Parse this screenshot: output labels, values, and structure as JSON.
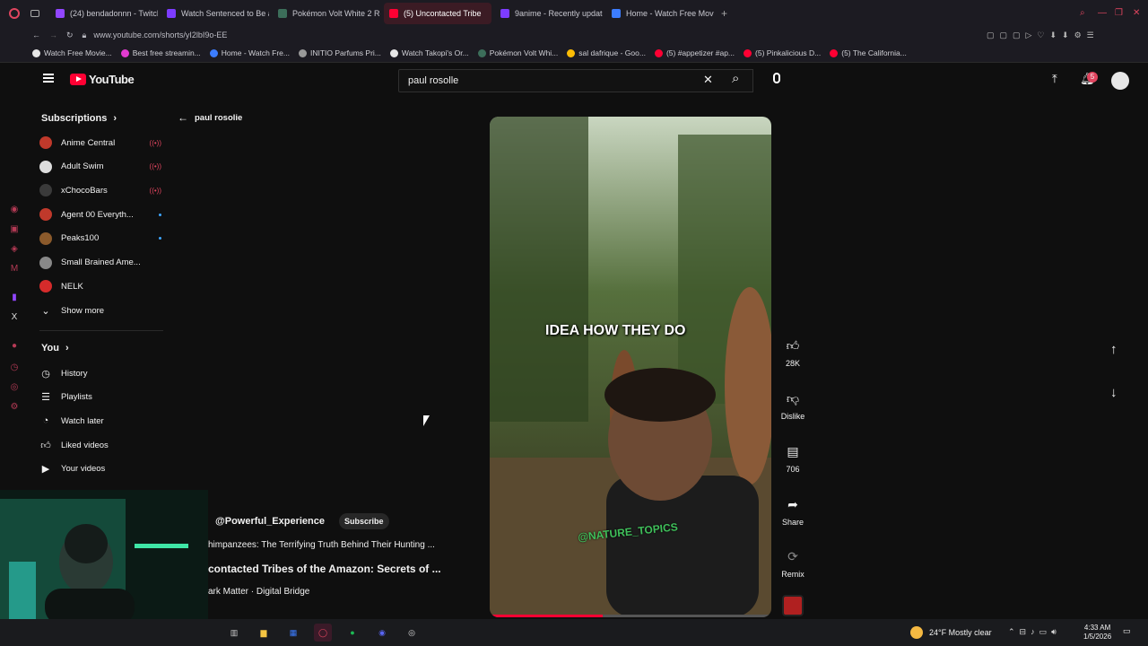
{
  "browser": {
    "tabs": [
      {
        "label": "(24) bendadonnn - Twitch",
        "color": "#9146ff"
      },
      {
        "label": "Watch Sentenced to Be a",
        "color": "#7d3cff"
      },
      {
        "label": "Pokémon Volt White 2 Re",
        "color": "#3c6e5a"
      },
      {
        "label": "(5) Uncontacted Tribe",
        "color": "#ff0033",
        "active": true
      },
      {
        "label": "9anime - Recently update",
        "color": "#7d3cff"
      },
      {
        "label": "Home - Watch Free Movie",
        "color": "#3c7dff"
      }
    ],
    "url": "www.youtube.com/shorts/yI2lbI9o-EE",
    "bookmarks": [
      {
        "label": "Watch Free Movie...",
        "color": "#e6e6e6"
      },
      {
        "label": "Best free streamin...",
        "color": "#e23bd0"
      },
      {
        "label": "Home - Watch Fre...",
        "color": "#3c7dff"
      },
      {
        "label": "INITIO Parfums Pri...",
        "color": "#999999"
      },
      {
        "label": "Watch Takopi's Or...",
        "color": "#e6e6e6"
      },
      {
        "label": "Pokémon Volt Whi...",
        "color": "#3c6e5a"
      },
      {
        "label": "sal dafrique - Goo...",
        "color": "#fbbc05"
      },
      {
        "label": "(5) #appetizer #ap...",
        "color": "#ff0033"
      },
      {
        "label": "(5) Pinkalicious D...",
        "color": "#ff0033"
      },
      {
        "label": "(5) The California...",
        "color": "#ff0033"
      }
    ]
  },
  "youtube": {
    "logo_text": "YouTube",
    "search_value": "paul rosolle",
    "notification_count": "5",
    "back_label": "paul rosolie",
    "guide": {
      "subscriptions_title": "Subscriptions",
      "subscriptions": [
        {
          "label": "Anime Central",
          "color": "#c0392b",
          "status": "live"
        },
        {
          "label": "Adult Swim",
          "color": "#dddddd",
          "status": "live"
        },
        {
          "label": "xChocoBars",
          "color": "#3a3a3a",
          "status": "live"
        },
        {
          "label": "Agent 00 Everyth...",
          "color": "#c0392b",
          "status": "new"
        },
        {
          "label": "Peaks100",
          "color": "#8b5a2b",
          "status": "new"
        },
        {
          "label": "Small Brained Ame...",
          "color": "#888888",
          "status": "none"
        },
        {
          "label": "NELK",
          "color": "#d62b2b",
          "status": "none"
        }
      ],
      "show_more": "Show more",
      "you_title": "You",
      "you_items": [
        {
          "label": "History",
          "icon": "history-icon"
        },
        {
          "label": "Playlists",
          "icon": "playlists-icon"
        },
        {
          "label": "Watch later",
          "icon": "watch-later-icon"
        },
        {
          "label": "Liked videos",
          "icon": "liked-videos-icon"
        },
        {
          "label": "Your videos",
          "icon": "your-videos-icon"
        }
      ]
    },
    "short": {
      "caption": "IDEA HOW THEY DO",
      "watermark": "@NATURE_TOPICS",
      "channel": "@Powerful_Experience",
      "subscribe": "Subscribe",
      "line1": "himpanzees: The Terrifying Truth Behind Their Hunting ...",
      "line2": "contacted Tribes of the Amazon: Secrets of ...",
      "line3": "ark Matter · Digital Bridge"
    },
    "actions": {
      "likes": "28K",
      "dislike": "Dislike",
      "comments": "706",
      "share": "Share",
      "remix": "Remix"
    }
  },
  "taskbar": {
    "weather": "24°F  Mostly clear",
    "time": "4:33 AM",
    "date": "1/5/2026"
  }
}
